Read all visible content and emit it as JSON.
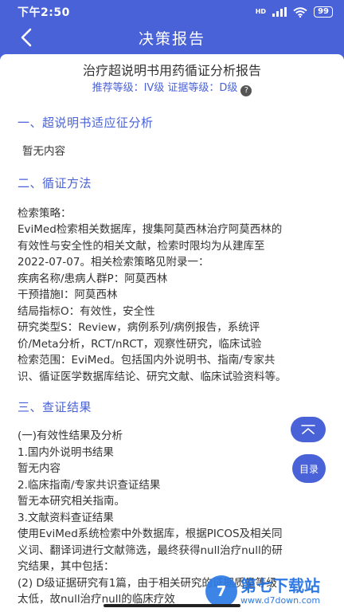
{
  "status": {
    "time": "下午2:50",
    "battery": "99"
  },
  "nav": {
    "title": "决策报告"
  },
  "report": {
    "title": "治疗超说明书用药循证分析报告",
    "grade": "推荐等级：IV级 证据等级：D级"
  },
  "section1": {
    "heading": "一、超说明书适应征分析",
    "text": "暂无内容"
  },
  "section2": {
    "heading": "二、循证方法",
    "lines": [
      "检索策略：",
      "EviMed检索相关数据库，搜集阿莫西林治疗阿莫西林的",
      "有效性与安全性的相关文献，检索时限均为从建库至",
      "2022-07-07。相关检索策略见附录一：",
      "疾病名称/患病人群P：阿莫西林",
      "干预措施I：阿莫西林",
      "结局指标O：有效性，安全性",
      "研究类型S：Review，病例系列/病例报告，系统评",
      "价/Meta分析，RCT/nRCT，观察性研究，临床试验",
      "检索范围：EviMed。包括国内外说明书、指南/专家共",
      "识、循证医学数据库结论、研究文献、临床试验资料等。"
    ]
  },
  "section3": {
    "heading": "三、查证结果",
    "lines": [
      "(一)有效性结果及分析",
      "1.国内外说明书结果",
      "暂无内容",
      "2.临床指南/专家共识查证结果",
      "暂无本研究相关指南。",
      "3.文献资料查证结果",
      "使用EviMed系统检索中外数据库，根据PICOS及相关同",
      "义词、翻译词进行文献筛选，最终获得null治疗null的研",
      "究结果，其中包括：",
      "(2) D级证据研究有1篇，由于相关研究的证据质量等级",
      "太低，故null治疗null的临床疗效"
    ]
  },
  "fab": {
    "toc_label": "目录"
  },
  "watermark": {
    "name": "第七下载站",
    "url": "www.d7down.com"
  }
}
